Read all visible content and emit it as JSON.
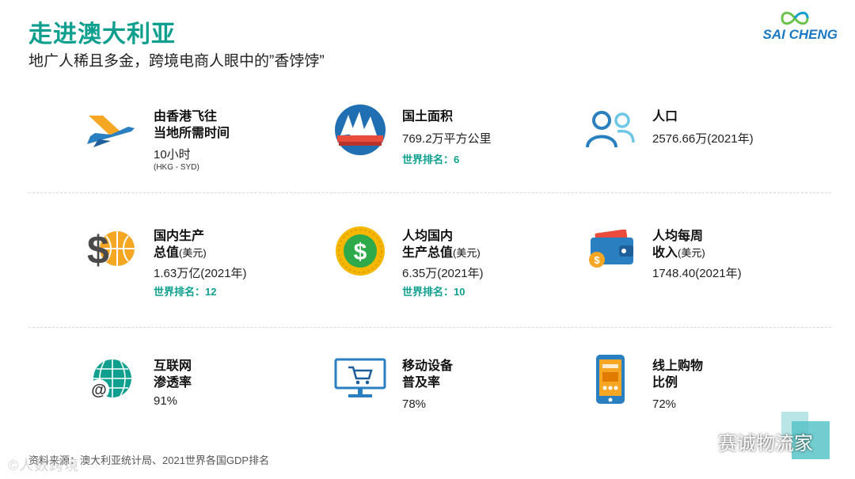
{
  "header": {
    "title": "走进澳大利亚",
    "subtitle": "地广人稀且多金，跨境电商人眼中的”香饽饽”",
    "logo_text": "SAI CHENG"
  },
  "items": {
    "flight": {
      "label1": "由香港飞往",
      "label2": "当地所需时间",
      "value": "10小时",
      "note": "(HKG - SYD)",
      "icon": "airplane-icon"
    },
    "area": {
      "label": "国土面积",
      "value": "769.2万平方公里",
      "rank": "世界排名：6",
      "icon": "sydney-opera-house-icon"
    },
    "population": {
      "label": "人口",
      "value": "2576.66万(2021年)",
      "icon": "people-icon"
    },
    "gdp": {
      "label1": "国内生产",
      "label2": "总值",
      "unit": "(美元)",
      "value": "1.63万亿(2021年)",
      "rank": "世界排名：12",
      "icon": "dollar-globe-icon"
    },
    "gdp_per_capita": {
      "label1": "人均国内",
      "label2": "生产总值",
      "unit": "(美元)",
      "value": "6.35万(2021年)",
      "rank": "世界排名：10",
      "icon": "dollar-coin-icon"
    },
    "weekly_income": {
      "label1": "人均每周",
      "label2": "收入",
      "unit": "(美元)",
      "value": "1748.40(2021年)",
      "icon": "wallet-icon"
    },
    "internet": {
      "label1": "互联网",
      "label2": "渗透率",
      "value": "91%",
      "icon": "internet-globe-icon"
    },
    "mobile": {
      "label1": "移动设备",
      "label2": "普及率",
      "value": "78%",
      "icon": "monitor-cart-icon"
    },
    "online_shopping": {
      "label1": "线上购物",
      "label2": "比例",
      "value": "72%",
      "icon": "smartphone-shop-icon"
    }
  },
  "footer": {
    "source": "资料来源：澳大利亚统计局、2021世界各国GDP排名",
    "watermark_left": "©人数跨境",
    "watermark_right": "赛诚物流家"
  },
  "colors": {
    "accent": "#0e9f8e",
    "logo": "#1a78c2",
    "orange": "#f5a623",
    "blue": "#2a7fc1"
  }
}
